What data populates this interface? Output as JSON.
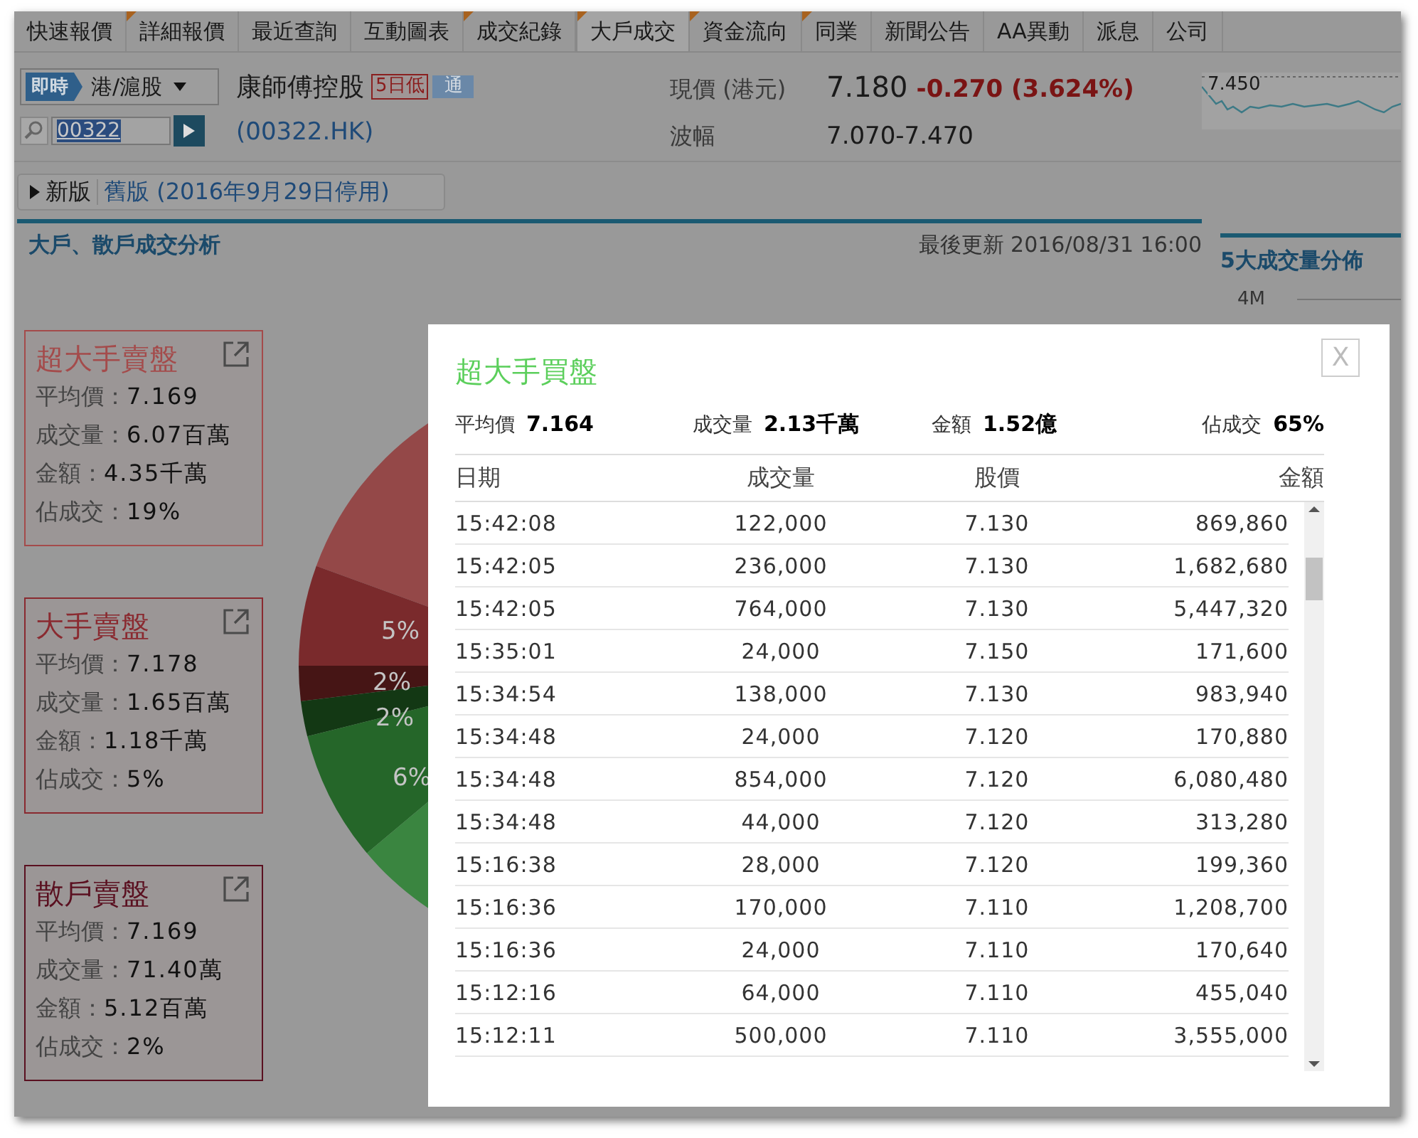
{
  "tabs": [
    {
      "label": "快速報價",
      "selected": false,
      "marked": false
    },
    {
      "label": "詳細報價",
      "selected": false,
      "marked": true
    },
    {
      "label": "最近查詢",
      "selected": false,
      "marked": false
    },
    {
      "label": "互動圖表",
      "selected": false,
      "marked": false
    },
    {
      "label": "成交紀錄",
      "selected": false,
      "marked": true
    },
    {
      "label": "大戶成交",
      "selected": true,
      "marked": true
    },
    {
      "label": "資金流向",
      "selected": false,
      "marked": true
    },
    {
      "label": "同業",
      "selected": false,
      "marked": true
    },
    {
      "label": "新聞公告",
      "selected": false,
      "marked": false
    },
    {
      "label": "AA異動",
      "selected": false,
      "marked": false
    },
    {
      "label": "派息",
      "selected": false,
      "marked": false
    },
    {
      "label": "公司",
      "selected": false,
      "marked": false
    }
  ],
  "quote": {
    "market_badge": "即時",
    "market": "港/滬股",
    "code": "00322",
    "name": "康師傅控股",
    "badges": [
      {
        "label": "5日低",
        "kind": "low"
      },
      {
        "label": "通",
        "kind": "connect"
      }
    ],
    "symbol": "(00322.HK)",
    "price_label": "現價 (港元)",
    "price": "7.180",
    "change": "-0.270 (3.624%)",
    "range_label": "波幅",
    "range": "7.070-7.470"
  },
  "sparkline": {
    "label": "7.450"
  },
  "versions": [
    {
      "label": "新版",
      "selected": true
    },
    {
      "label": "舊版 (2016年9月29日停用)",
      "selected": false
    }
  ],
  "section": {
    "title": "大戶、散戶成交分析",
    "updated": "最後更新 2016/08/31 16:00"
  },
  "side_panel": {
    "title": "5大成交量分佈",
    "axis_label": "4M"
  },
  "cards": [
    {
      "title": "超大手賣盤",
      "color": "#a44b4b",
      "stats": [
        {
          "label": "平均價：",
          "value": "7.169"
        },
        {
          "label": "成交量：",
          "value": "6.07百萬"
        },
        {
          "label": "金額：",
          "value": "4.35千萬"
        },
        {
          "label": "佔成交：",
          "value": "19%"
        }
      ]
    },
    {
      "title": "大手賣盤",
      "color": "#8a2a30",
      "stats": [
        {
          "label": "平均價：",
          "value": "7.178"
        },
        {
          "label": "成交量：",
          "value": "1.65百萬"
        },
        {
          "label": "金額：",
          "value": "1.18千萬"
        },
        {
          "label": "佔成交：",
          "value": "5%"
        }
      ]
    },
    {
      "title": "散戶賣盤",
      "color": "#5a1020",
      "stats": [
        {
          "label": "平均價：",
          "value": "7.169"
        },
        {
          "label": "成交量：",
          "value": "71.40萬"
        },
        {
          "label": "金額：",
          "value": "5.12百萬"
        },
        {
          "label": "佔成交：",
          "value": "2%"
        }
      ]
    }
  ],
  "pie_labels": [
    "5%",
    "2%",
    "2%",
    "6%"
  ],
  "modal": {
    "title": "超大手買盤",
    "close": "X",
    "summary": [
      {
        "label": "平均價",
        "value": "7.164"
      },
      {
        "label": "成交量",
        "value": "2.13千萬"
      },
      {
        "label": "金額",
        "value": "1.52億"
      },
      {
        "label": "佔成交",
        "value": "65%"
      }
    ],
    "columns": [
      "日期",
      "成交量",
      "股價",
      "金額"
    ],
    "rows": [
      [
        "15:42:08",
        "122,000",
        "7.130",
        "869,860"
      ],
      [
        "15:42:05",
        "236,000",
        "7.130",
        "1,682,680"
      ],
      [
        "15:42:05",
        "764,000",
        "7.130",
        "5,447,320"
      ],
      [
        "15:35:01",
        "24,000",
        "7.150",
        "171,600"
      ],
      [
        "15:34:54",
        "138,000",
        "7.130",
        "983,940"
      ],
      [
        "15:34:48",
        "24,000",
        "7.120",
        "170,880"
      ],
      [
        "15:34:48",
        "854,000",
        "7.120",
        "6,080,480"
      ],
      [
        "15:34:48",
        "44,000",
        "7.120",
        "313,280"
      ],
      [
        "15:16:38",
        "28,000",
        "7.120",
        "199,360"
      ],
      [
        "15:16:36",
        "170,000",
        "7.110",
        "1,208,700"
      ],
      [
        "15:16:36",
        "24,000",
        "7.110",
        "170,640"
      ],
      [
        "15:12:16",
        "64,000",
        "7.110",
        "455,040"
      ],
      [
        "15:12:11",
        "500,000",
        "7.110",
        "3,555,000"
      ]
    ]
  }
}
